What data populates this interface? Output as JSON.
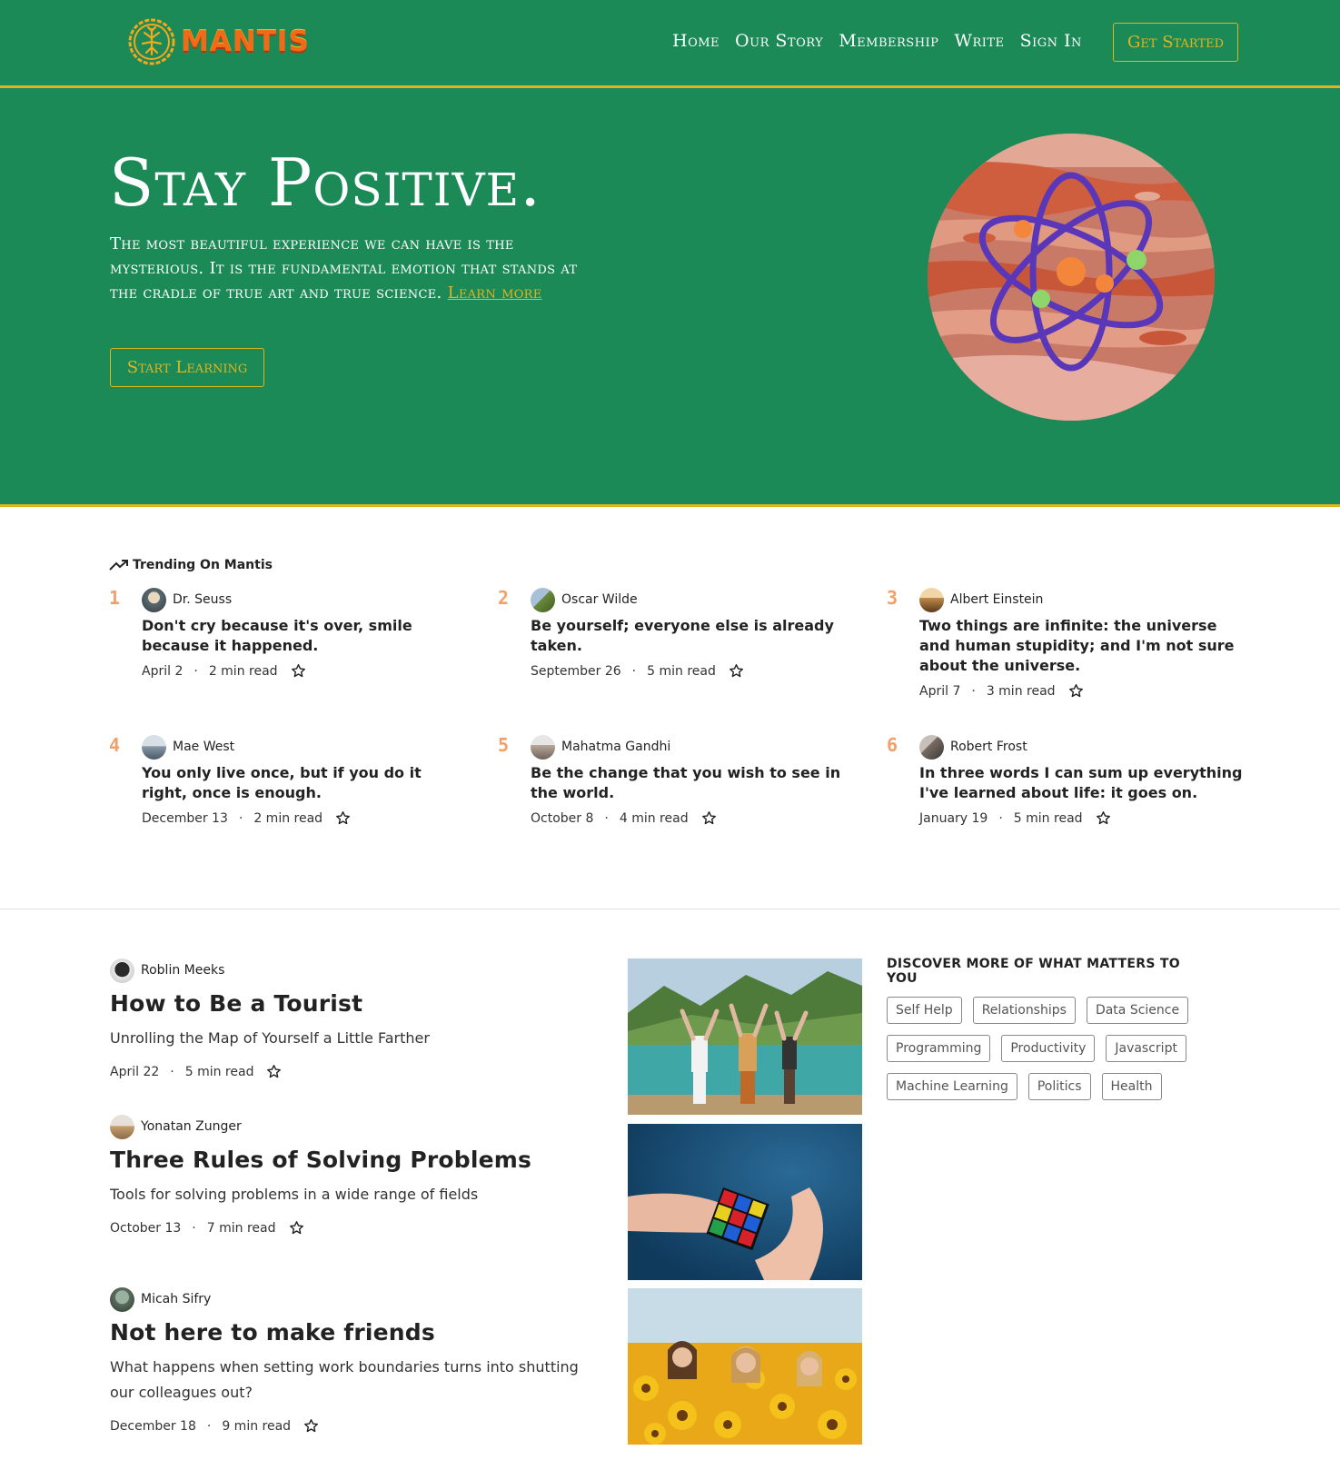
{
  "brand": {
    "name": "MANTIS"
  },
  "nav": {
    "items": [
      "Home",
      "Our Story",
      "Membership",
      "Write",
      "Sign In"
    ],
    "cta": "Get Started"
  },
  "hero": {
    "title": "Stay Positive.",
    "text": "The most beautiful experience we can have is the mysterious. It is the fundamental emotion that stands at the cradle of true art and true science.",
    "link": "Learn more",
    "button": "Start Learning"
  },
  "trending": {
    "heading": "Trending On Mantis",
    "items": [
      {
        "rank": "1",
        "author": "Dr. Seuss",
        "title": "Don't cry because it's over, smile because it happened.",
        "date": "April 2",
        "read": "2 min read"
      },
      {
        "rank": "2",
        "author": "Oscar Wilde",
        "title": "Be yourself; everyone else is already taken.",
        "date": "September 26",
        "read": "5 min read"
      },
      {
        "rank": "3",
        "author": "Albert Einstein",
        "title": "Two things are infinite: the universe and human stupidity; and I'm not sure about the universe.",
        "date": "April 7",
        "read": "3 min read"
      },
      {
        "rank": "4",
        "author": "Mae West",
        "title": "You only live once, but if you do it right, once is enough.",
        "date": "December 13",
        "read": "2 min read"
      },
      {
        "rank": "5",
        "author": "Mahatma Gandhi",
        "title": "Be the change that you wish to see in the world.",
        "date": "October 8",
        "read": "4 min read"
      },
      {
        "rank": "6",
        "author": "Robert Frost",
        "title": "In three words I can sum up everything I've learned about life: it goes on.",
        "date": "January 19",
        "read": "5 min read"
      }
    ]
  },
  "posts": [
    {
      "author": "Roblin Meeks",
      "title": "How to Be a Tourist",
      "subtitle": "Unrolling the Map of Yourself a Little Farther",
      "date": "April 22",
      "read": "5 min read"
    },
    {
      "author": "Yonatan Zunger",
      "title": "Three Rules of Solving Problems",
      "subtitle": "Tools for solving problems in a wide range of fields",
      "date": "October 13",
      "read": "7 min read"
    },
    {
      "author": "Micah Sifry",
      "title": "Not here to make friends",
      "subtitle": "What happens when setting work boundaries turns into shutting our colleagues out?",
      "date": "December 18",
      "read": "9 min read"
    }
  ],
  "discover": {
    "heading": "DISCOVER MORE OF WHAT MATTERS TO YOU",
    "tags": [
      "Self Help",
      "Relationships",
      "Data Science",
      "Programming",
      "Productivity",
      "Javascript",
      "Machine Learning",
      "Politics",
      "Health"
    ]
  },
  "colors": {
    "green": "#1b8a57",
    "gold": "#e0b421",
    "rank": "#f0a06a"
  },
  "icons": {
    "logo": "mantis-logo-icon",
    "trend": "trending-up-icon",
    "bookmark": "star-icon"
  }
}
